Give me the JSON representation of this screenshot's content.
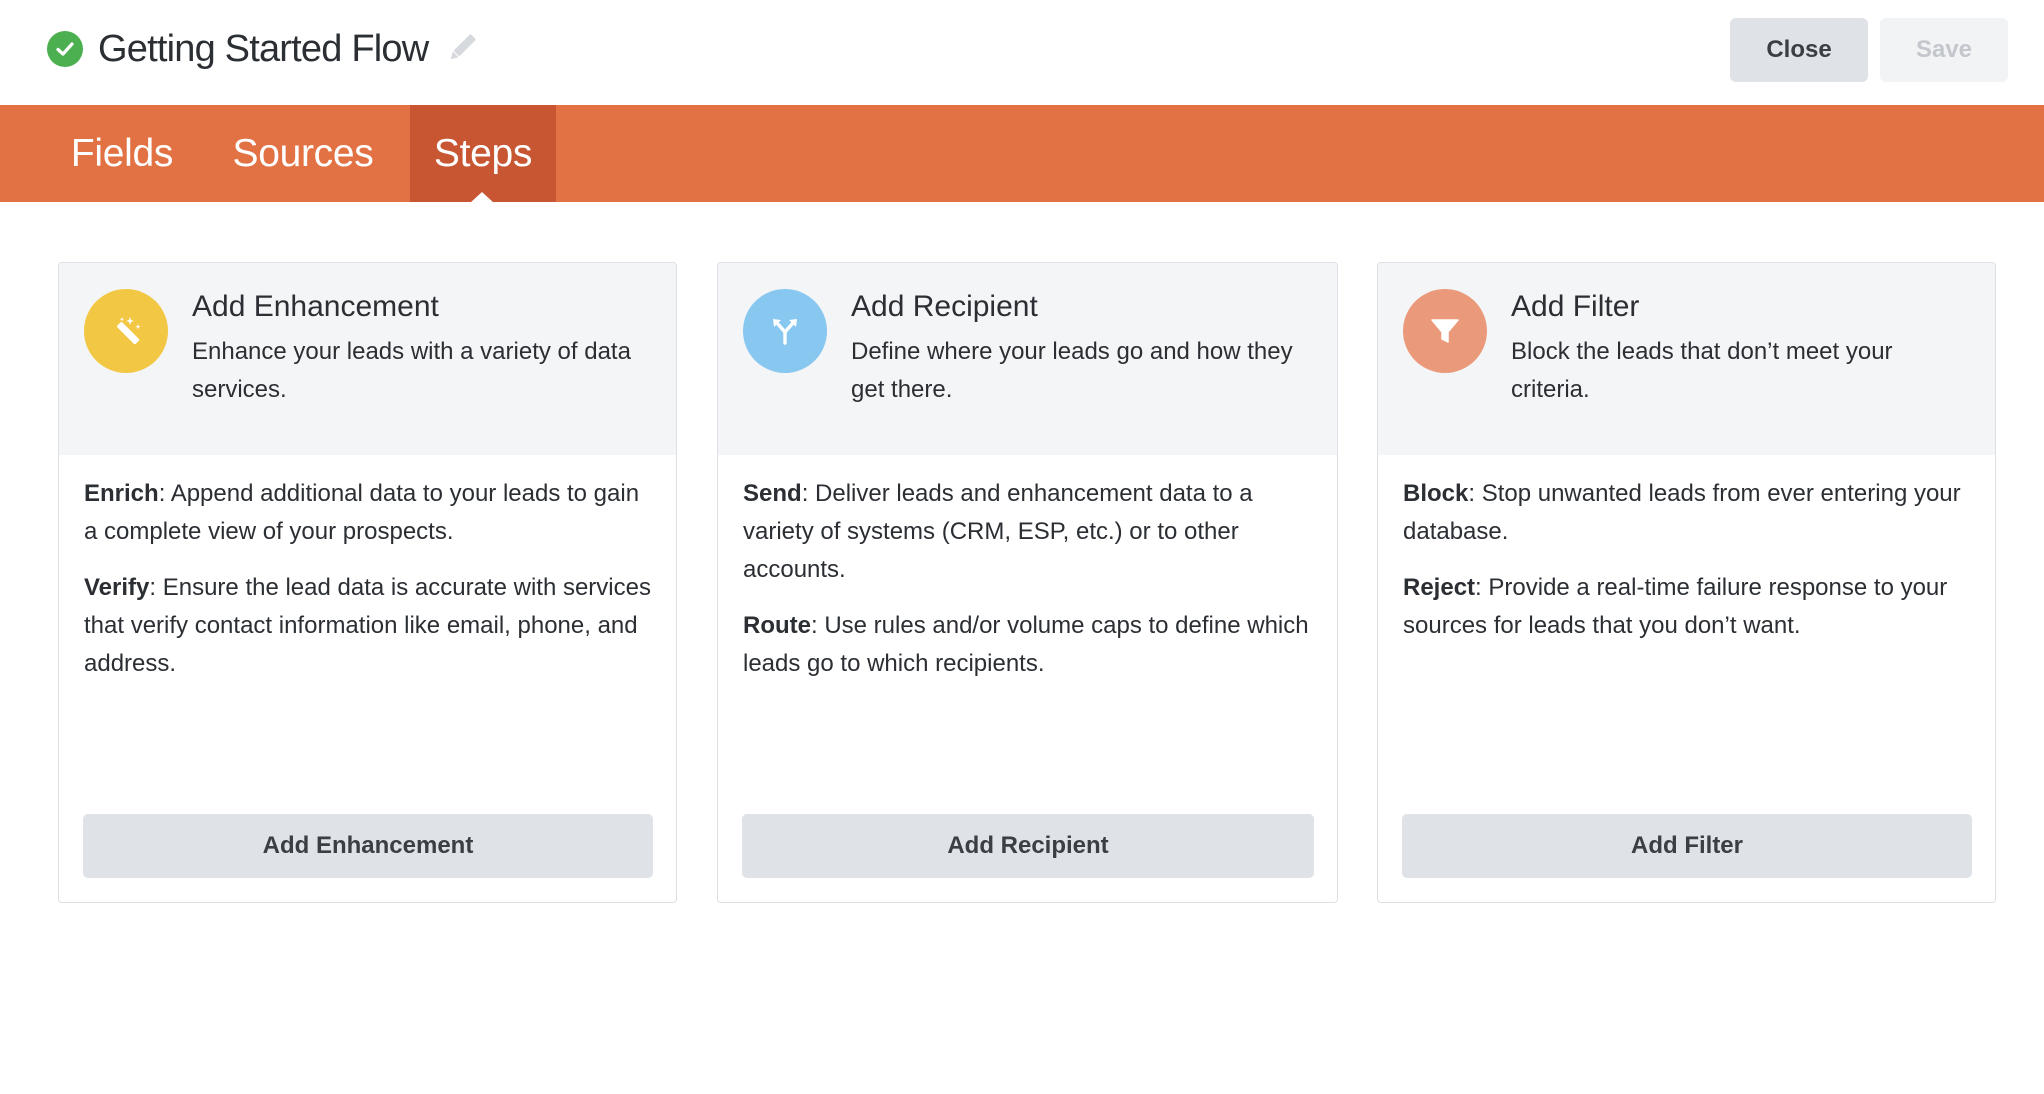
{
  "header": {
    "title": "Getting Started Flow",
    "close_label": "Close",
    "save_label": "Save"
  },
  "nav": {
    "tabs": [
      {
        "label": "Fields"
      },
      {
        "label": "Sources"
      },
      {
        "label": "Steps",
        "active": true
      }
    ]
  },
  "cards": [
    {
      "title": "Add Enhancement",
      "subtitle": "Enhance your leads with a variety of data services.",
      "icon": "magic-wand-icon",
      "color": "#f2c744",
      "items": [
        {
          "term": "Enrich",
          "text": ": Append additional data to your leads to gain a complete view of your prospects."
        },
        {
          "term": "Verify",
          "text": ": Ensure the lead data is accurate with services that verify contact information like email, phone, and address."
        }
      ],
      "button": "Add Enhancement"
    },
    {
      "title": "Add Recipient",
      "subtitle": "Define where your leads go and how they get there.",
      "icon": "split-arrows-icon",
      "color": "#87c7f0",
      "items": [
        {
          "term": "Send",
          "text": ": Deliver leads and enhancement data to a variety of systems (CRM, ESP, etc.) or to other accounts."
        },
        {
          "term": "Route",
          "text": ": Use rules and/or volume caps to define which leads go to which recipients."
        }
      ],
      "button": "Add Recipient"
    },
    {
      "title": "Add Filter",
      "subtitle": "Block the leads that don’t meet your criteria.",
      "icon": "funnel-icon",
      "color": "#ea9a7a",
      "items": [
        {
          "term": "Block",
          "text": ": Stop unwanted leads from ever entering your database."
        },
        {
          "term": "Reject",
          "text": ": Provide a real-time failure response to your sources for leads that you don’t want."
        }
      ],
      "button": "Add Filter"
    }
  ],
  "colors": {
    "nav_bg": "#e27243",
    "nav_active": "#c85632",
    "status_ok": "#4caf50"
  }
}
